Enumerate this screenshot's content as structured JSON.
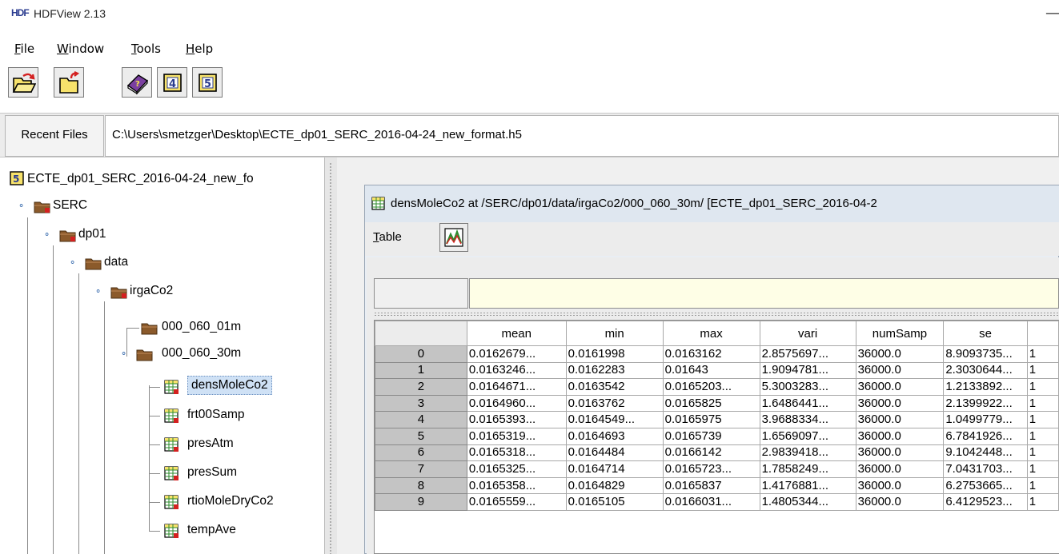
{
  "window": {
    "title": "HDFView 2.13",
    "logo": "HDF",
    "minimize_glyph": "—"
  },
  "menu": [
    {
      "mnemonic": "F",
      "rest": "ile"
    },
    {
      "mnemonic": "W",
      "rest": "indow"
    },
    {
      "mnemonic": "T",
      "rest": "ools"
    },
    {
      "mnemonic": "H",
      "rest": "elp"
    }
  ],
  "toolbar_icons": [
    "open-file-icon",
    "open-recent-icon",
    "help-book-icon",
    "hdf4-library-icon",
    "hdf5-library-icon"
  ],
  "toolbar_glyphs": {
    "hdf4": "4",
    "hdf5": "5"
  },
  "recent": {
    "label": "Recent Files",
    "path": "C:\\Users\\smetzger\\Desktop\\ECTE_dp01_SERC_2016-04-24_new_format.h5"
  },
  "tree": {
    "root_badge": "5",
    "root": "ECTE_dp01_SERC_2016-04-24_new_fo",
    "nodes": [
      "SERC",
      "dp01",
      "data",
      "irgaCo2",
      "000_060_01m",
      "000_060_30m",
      "densMoleCo2",
      "frt00Samp",
      "presAtm",
      "presSum",
      "rtioMoleDryCo2",
      "tempAve"
    ]
  },
  "dataset_window": {
    "title": "densMoleCo2  at  /SERC/dp01/data/irgaCo2/000_060_30m/  [ECTE_dp01_SERC_2016-04-2",
    "menu_table": "Table",
    "menu_table_mnemonic": "T",
    "menu_table_rest": "able"
  },
  "table": {
    "columns": [
      "mean",
      "min",
      "max",
      "vari",
      "numSamp",
      "se",
      ""
    ],
    "rows": [
      [
        "0",
        "0.0162679...",
        "0.0161998",
        "0.0163162",
        "2.8575697...",
        "36000.0",
        "8.9093735...",
        "1"
      ],
      [
        "1",
        "0.0163246...",
        "0.0162283",
        "0.01643",
        "1.9094781...",
        "36000.0",
        "2.3030644...",
        "1"
      ],
      [
        "2",
        "0.0164671...",
        "0.0163542",
        "0.0165203...",
        "5.3003283...",
        "36000.0",
        "1.2133892...",
        "1"
      ],
      [
        "3",
        "0.0164960...",
        "0.0163762",
        "0.0165825",
        "1.6486441...",
        "36000.0",
        "2.1399922...",
        "1"
      ],
      [
        "4",
        "0.0165393...",
        "0.0164549...",
        "0.0165975",
        "3.9688334...",
        "36000.0",
        "1.0499779...",
        "1"
      ],
      [
        "5",
        "0.0165319...",
        "0.0164693",
        "0.0165739",
        "1.6569097...",
        "36000.0",
        "6.7841926...",
        "1"
      ],
      [
        "6",
        "0.0165318...",
        "0.0164484",
        "0.0166142",
        "2.9839418...",
        "36000.0",
        "9.1042448...",
        "1"
      ],
      [
        "7",
        "0.0165325...",
        "0.0164714",
        "0.0165723...",
        "1.7858249...",
        "36000.0",
        "7.0431703...",
        "1"
      ],
      [
        "8",
        "0.0165358...",
        "0.0164829",
        "0.0165837",
        "1.4176881...",
        "36000.0",
        "6.2753665...",
        "1"
      ],
      [
        "9",
        "0.0165559...",
        "0.0165105",
        "0.0166031...",
        "1.4805344...",
        "36000.0",
        "6.4129523...",
        "1"
      ]
    ]
  },
  "colors": {
    "folder": "#8b5a2b",
    "folder_dark": "#5a3a1a",
    "dataset_green": "#2e8b2e",
    "selection": "#cfe1f5",
    "row_header": "#c4c4c4",
    "cell_bg": "#fefee6"
  }
}
